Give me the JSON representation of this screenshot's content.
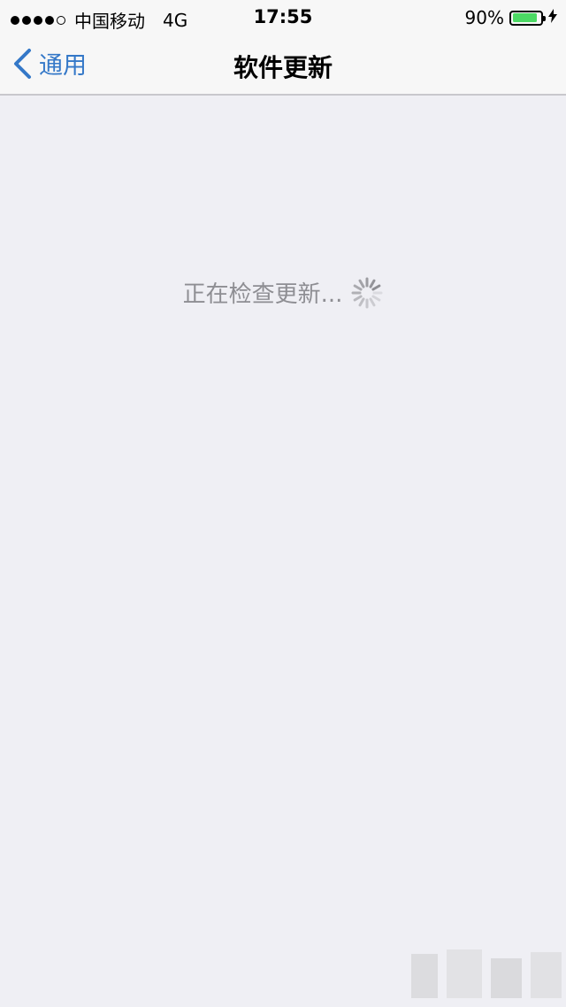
{
  "status_bar": {
    "carrier": "中国移动",
    "network": "4G",
    "time": "17:55",
    "battery_level": "90%",
    "battery_fraction": 0.9,
    "battery_color": "#4cd964"
  },
  "nav": {
    "back_label": "通用",
    "title": "软件更新"
  },
  "content": {
    "checking_text": "正在检查更新..."
  },
  "colors": {
    "accent": "#3478c8",
    "background": "#efeff4",
    "secondary_text": "#8e8e93"
  },
  "icons": {
    "back": "chevron-left-icon",
    "spinner": "activity-spinner-icon",
    "battery": "battery-icon",
    "charging": "bolt-icon",
    "signal": "signal-dots-icon"
  }
}
